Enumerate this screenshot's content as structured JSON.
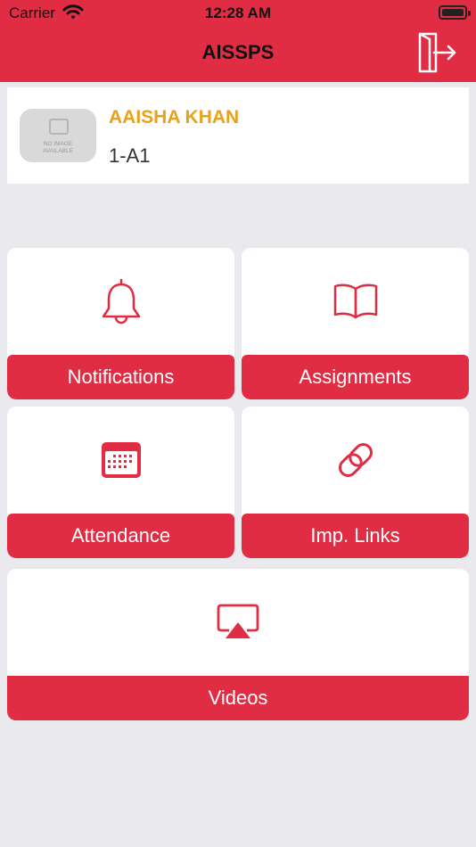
{
  "status_bar": {
    "carrier": "Carrier",
    "time": "12:28 AM"
  },
  "header": {
    "title": "AISSPS"
  },
  "profile": {
    "name": "AAISHA KHAN",
    "class_section": "1-A1",
    "avatar_placeholder_line1": "NO IMAGE",
    "avatar_placeholder_line2": "AVAILABLE"
  },
  "menu": [
    {
      "label": "Notifications",
      "icon": "bell-icon"
    },
    {
      "label": "Assignments",
      "icon": "book-icon"
    },
    {
      "label": "Attendance",
      "icon": "calendar-icon"
    },
    {
      "label": "Imp. Links",
      "icon": "link-icon"
    },
    {
      "label": "Videos",
      "icon": "airplay-icon"
    }
  ],
  "colors": {
    "brand_red": "#e02d43",
    "name_gold": "#e8a21a",
    "background": "#e9e9ee"
  }
}
